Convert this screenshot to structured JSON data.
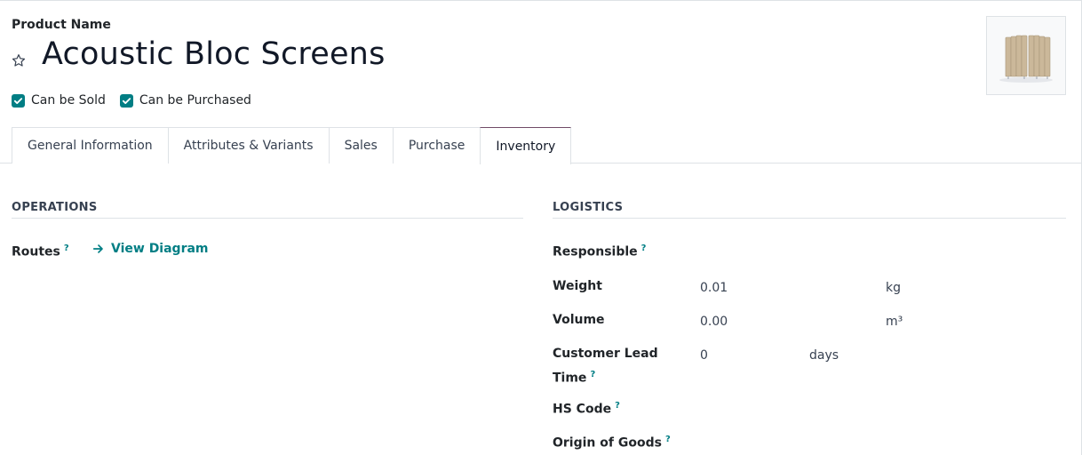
{
  "header": {
    "field_label": "Product Name",
    "product_name": "Acoustic Bloc Screens",
    "star_icon": "star-outline-icon",
    "can_be_sold": {
      "label": "Can be Sold",
      "checked": true
    },
    "can_be_purchased": {
      "label": "Can be Purchased",
      "checked": true
    },
    "image_icon": "product-image"
  },
  "tabs": [
    {
      "label": "General Information",
      "active": false
    },
    {
      "label": "Attributes & Variants",
      "active": false
    },
    {
      "label": "Sales",
      "active": false
    },
    {
      "label": "Purchase",
      "active": false
    },
    {
      "label": "Inventory",
      "active": true
    }
  ],
  "operations": {
    "title": "OPERATIONS",
    "routes_label": "Routes",
    "help_mark": "?",
    "view_diagram_label": "View Diagram"
  },
  "logistics": {
    "title": "LOGISTICS",
    "responsible_label": "Responsible",
    "weight_label": "Weight",
    "weight_value": "0.01",
    "weight_unit": "kg",
    "volume_label": "Volume",
    "volume_value": "0.00",
    "volume_unit": "m³",
    "lead_time_label_line1": "Customer Lead",
    "lead_time_label_line2": "Time",
    "lead_time_value": "0",
    "lead_time_unit": "days",
    "hs_code_label": "HS Code",
    "origin_label": "Origin of Goods"
  },
  "colors": {
    "accent": "#017e84",
    "active_tab_border": "#714b67"
  }
}
